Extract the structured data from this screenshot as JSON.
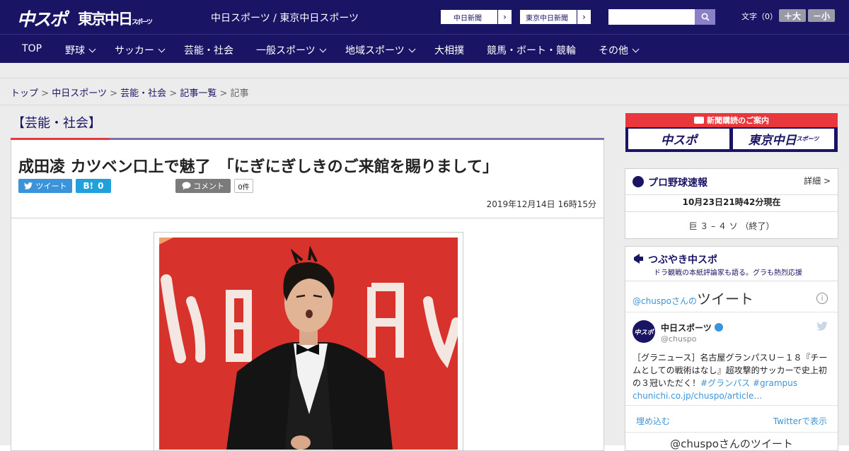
{
  "header": {
    "logo_main": "中スポ",
    "logo_tokyo": "東京中日",
    "logo_tokyo_small": "スポーツ",
    "site_title": "中日スポーツ / 東京中日スポーツ",
    "paper_links": [
      "中日新聞",
      "東京中日新聞"
    ],
    "search_placeholder": "",
    "font_size_label": "文字（0）",
    "font_up": "＋大",
    "font_down": "－小"
  },
  "nav": {
    "items": [
      {
        "label": "TOP",
        "dropdown": false
      },
      {
        "label": "野球",
        "dropdown": true
      },
      {
        "label": "サッカー",
        "dropdown": true
      },
      {
        "label": "芸能・社会",
        "dropdown": false
      },
      {
        "label": "一般スポーツ",
        "dropdown": true
      },
      {
        "label": "地域スポーツ",
        "dropdown": true
      },
      {
        "label": "大相撲",
        "dropdown": false
      },
      {
        "label": "競馬・ボート・競輪",
        "dropdown": false
      },
      {
        "label": "その他",
        "dropdown": true
      }
    ]
  },
  "breadcrumb": {
    "items": [
      "トップ",
      "中日スポーツ",
      "芸能・社会",
      "記事一覧"
    ],
    "current": "記事",
    "separator": ">"
  },
  "article": {
    "section": "【芸能・社会】",
    "title": "成田凌 カツベン口上で魅了　「にぎにぎしきのご来館を賜りまして」",
    "tweet_label": "ツイート",
    "hatena_label": "B!",
    "hatena_count": "0",
    "comment_label": "コメント",
    "comment_count": "0件",
    "date": "2019年12月14日 16時15分"
  },
  "sidebar": {
    "promo_title": "新聞購読のご案内",
    "promo_left": "中スポ",
    "promo_right": "東京中日",
    "promo_right_small": "スポーツ",
    "baseball": {
      "title": "プロ野球速報",
      "detail": "詳細 >",
      "time": "10月23日21時42分現在",
      "score": "巨 ３ – ４ ソ （終了）"
    },
    "tweets": {
      "title": "つぶやき中スポ",
      "subtitle": "ドラ観戦の本紙評論家も語る。グラも熱烈応援",
      "header_handle": "@chuspoさんの",
      "header_word": "ツイート",
      "author": "中日スポーツ",
      "handle": "@chuspo",
      "avatar_text": "中スポ",
      "text_plain": "［グラニュース］名古屋グランパスＵ－１８『チームとしての戦術はなし』超攻撃的サッカーで史上初の３冠いただく！",
      "hashtags": "#グランパス #grampus",
      "link": "chunichi.co.jp/chuspo/article…",
      "embed": "埋め込む",
      "view_on_twitter": "Twitterで表示",
      "footer": "@chuspoさんのツイート"
    }
  },
  "colors": {
    "brand_navy": "#1a1464",
    "accent_red": "#e8383d",
    "twitter_blue": "#3b94d9"
  }
}
